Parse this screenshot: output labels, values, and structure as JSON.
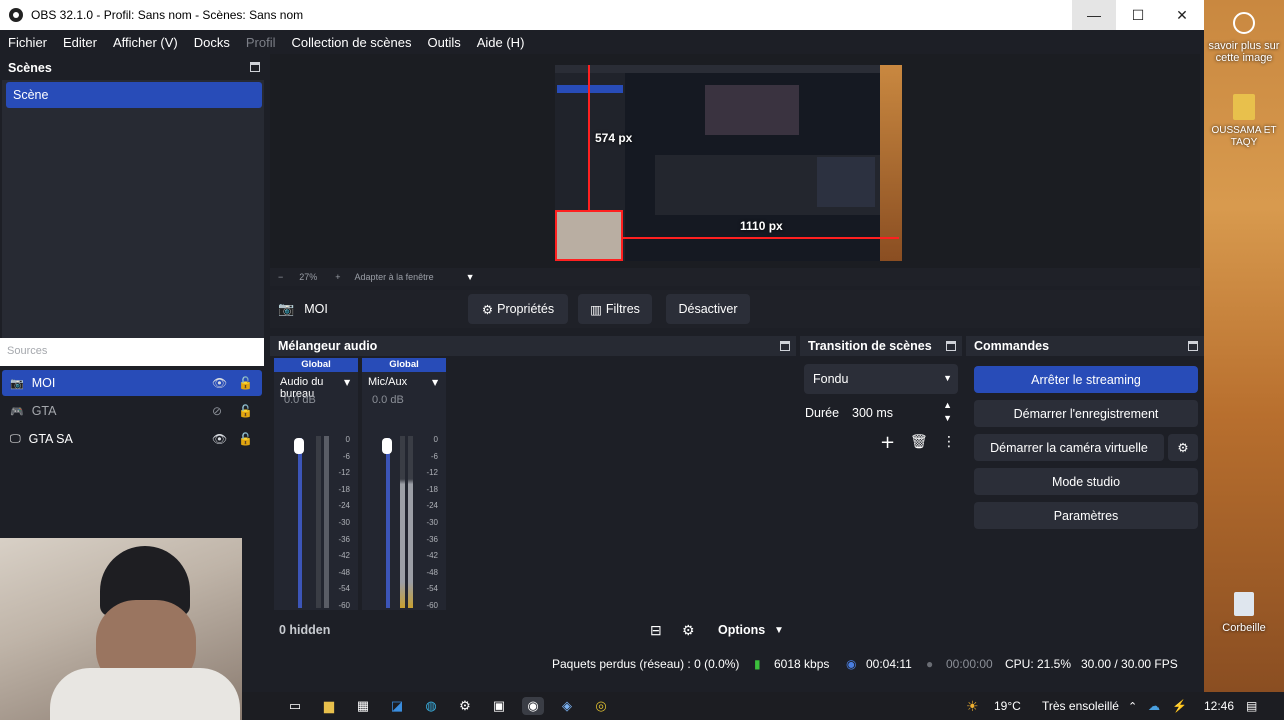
{
  "window": {
    "title": "OBS 32.1.0 - Profil: Sans nom - Scènes: Sans nom"
  },
  "menu": {
    "items": [
      "Fichier",
      "Editer",
      "Afficher (V)",
      "Docks"
    ],
    "disabled": "Profil",
    "items2": [
      "Collection de scènes",
      "Outils",
      "Aide (H)"
    ]
  },
  "scenes": {
    "header": "Scènes",
    "items": [
      "Scène"
    ]
  },
  "preview": {
    "zoom": "27%",
    "fit_label": "Adapter à la fenêtre",
    "label_v": "574 px",
    "label_h": "1110 px"
  },
  "source_bar": {
    "name": "MOI",
    "properties": "Propriétés",
    "filters": "Filtres",
    "deactivate": "Désactiver"
  },
  "sources": {
    "header": "Sources",
    "items": [
      {
        "name": "MOI",
        "visible": true
      },
      {
        "name": "GTA",
        "visible": false
      },
      {
        "name": "GTA SA",
        "visible": true
      }
    ]
  },
  "mixer": {
    "header": "Mélangeur audio",
    "channels": [
      {
        "label": "Global",
        "name": "Audio du bureau",
        "db": "0.0 dB"
      },
      {
        "label": "Global",
        "name": "Mic/Aux",
        "db": "0.0 dB"
      }
    ],
    "ticks": [
      "0",
      "-6",
      "-12",
      "-18",
      "-24",
      "-30",
      "-36",
      "-42",
      "-48",
      "-54",
      "-60"
    ],
    "hidden": "0 hidden",
    "options": "Options"
  },
  "transition": {
    "header": "Transition de scènes",
    "type": "Fondu",
    "duration_label": "Durée",
    "duration": "300 ms"
  },
  "commands": {
    "header": "Commandes",
    "stream": "Arrêter le streaming",
    "record": "Démarrer l'enregistrement",
    "virtualcam": "Démarrer la caméra virtuelle",
    "studio": "Mode studio",
    "settings": "Paramètres"
  },
  "status": {
    "dropped": "Paquets perdus (réseau) : 0 (0.0%)",
    "bitrate": "6018 kbps",
    "stream_time": "00:04:11",
    "rec_time": "00:00:00",
    "cpu": "CPU: 21.5%",
    "fps": "30.00 / 30.00 FPS"
  },
  "desktop": {
    "icon1": "savoir plus sur cette image",
    "icon2": "OUSSAMA ET TAQY",
    "trash": "Corbeille"
  },
  "taskbar": {
    "weather": "19°C",
    "weather_desc": "Très ensoleillé",
    "time": "12:46"
  }
}
